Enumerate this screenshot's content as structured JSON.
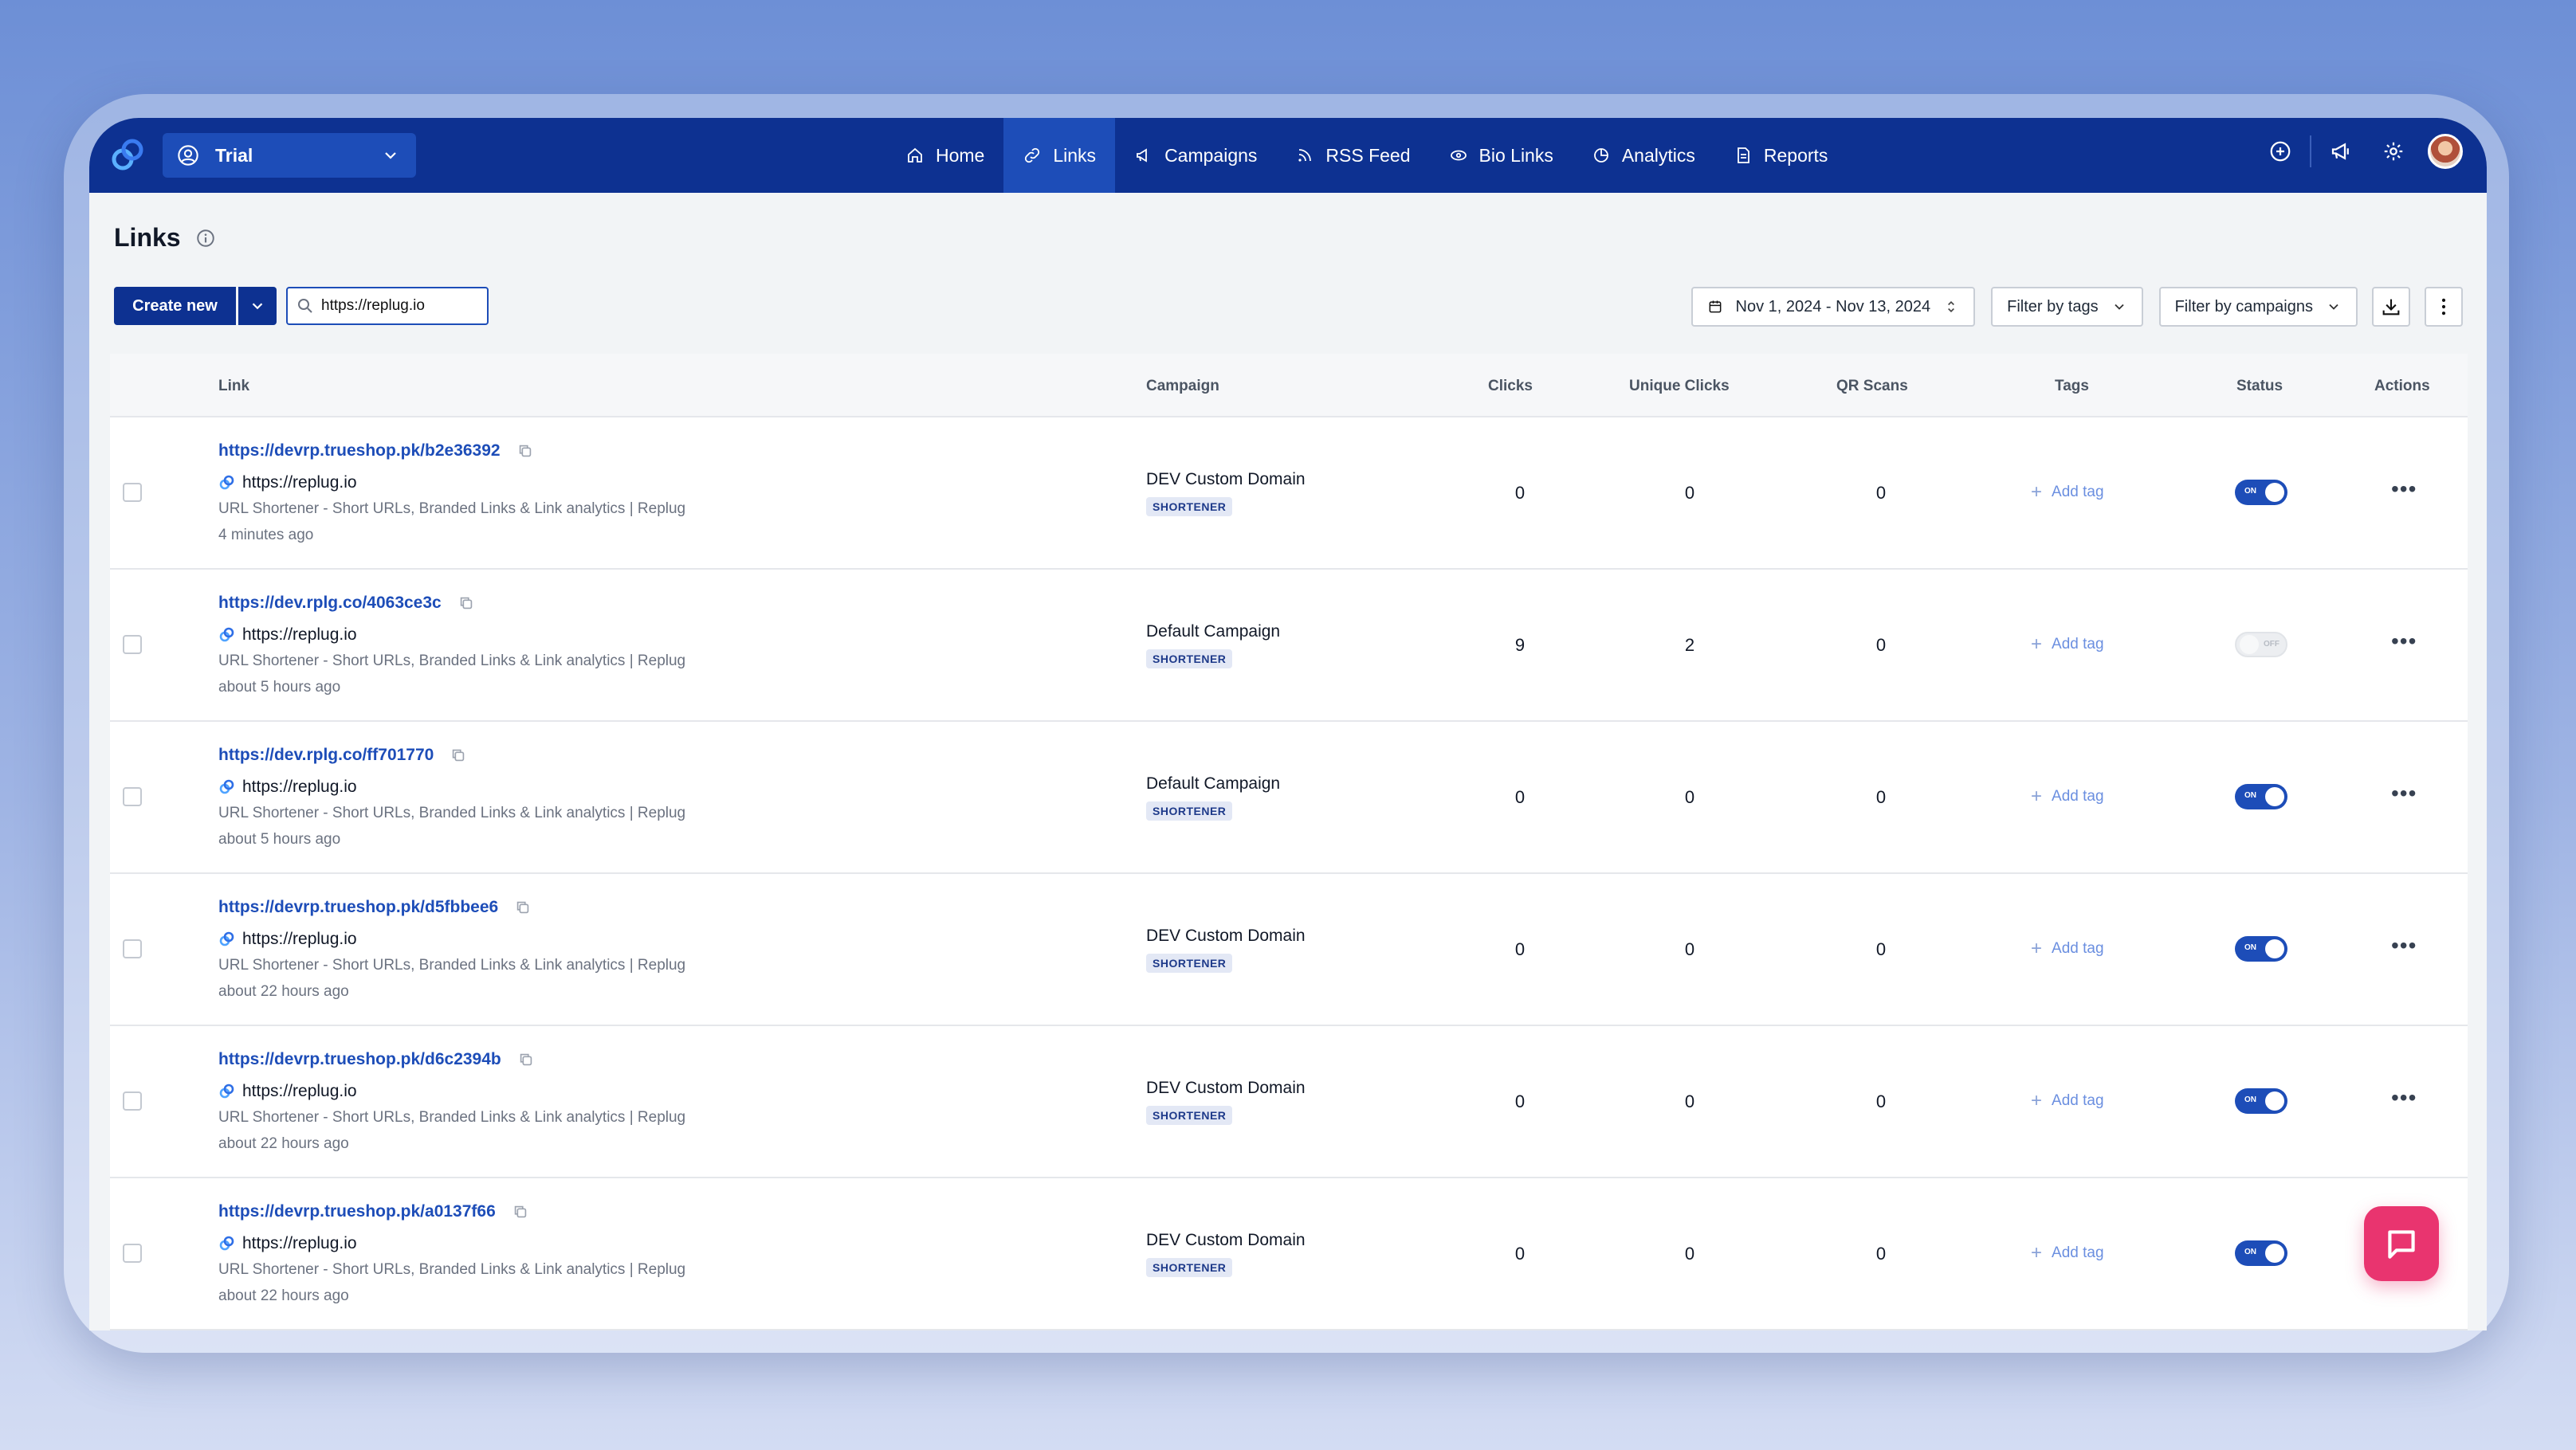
{
  "workspace": {
    "name": "Trial"
  },
  "nav": {
    "items": [
      {
        "label": "Home",
        "icon": "home-icon"
      },
      {
        "label": "Links",
        "icon": "link-icon",
        "active": true
      },
      {
        "label": "Campaigns",
        "icon": "megaphone-icon"
      },
      {
        "label": "RSS Feed",
        "icon": "rss-icon"
      },
      {
        "label": "Bio Links",
        "icon": "eye-link-icon"
      },
      {
        "label": "Analytics",
        "icon": "analytics-icon"
      },
      {
        "label": "Reports",
        "icon": "report-icon"
      }
    ]
  },
  "page": {
    "title": "Links"
  },
  "toolbar": {
    "create_label": "Create new",
    "search_value": "https://replug.io",
    "date_range": "Nov 1, 2024 - Nov 13, 2024",
    "filter_tags": "Filter by tags",
    "filter_campaigns": "Filter by campaigns"
  },
  "table": {
    "headers": {
      "link": "Link",
      "campaign": "Campaign",
      "clicks": "Clicks",
      "unique": "Unique Clicks",
      "qr": "QR Scans",
      "tags": "Tags",
      "status": "Status",
      "actions": "Actions"
    },
    "add_tag_label": "Add tag",
    "badge_label": "SHORTENER",
    "on_label": "ON",
    "off_label": "OFF",
    "rows": [
      {
        "short_url": "https://devrp.trueshop.pk/b2e36392",
        "destination": "https://replug.io",
        "meta": "URL Shortener - Short URLs, Branded Links & Link analytics | Replug",
        "time": "4 minutes ago",
        "campaign": "DEV Custom Domain",
        "clicks": "0",
        "unique_clicks": "0",
        "qr_scans": "0",
        "status": "on"
      },
      {
        "short_url": "https://dev.rplg.co/4063ce3c",
        "destination": "https://replug.io",
        "meta": "URL Shortener - Short URLs, Branded Links & Link analytics | Replug",
        "time": "about 5 hours ago",
        "campaign": "Default Campaign",
        "clicks": "9",
        "unique_clicks": "2",
        "qr_scans": "0",
        "status": "off"
      },
      {
        "short_url": "https://dev.rplg.co/ff701770",
        "destination": "https://replug.io",
        "meta": "URL Shortener - Short URLs, Branded Links & Link analytics | Replug",
        "time": "about 5 hours ago",
        "campaign": "Default Campaign",
        "clicks": "0",
        "unique_clicks": "0",
        "qr_scans": "0",
        "status": "on"
      },
      {
        "short_url": "https://devrp.trueshop.pk/d5fbbee6",
        "destination": "https://replug.io",
        "meta": "URL Shortener - Short URLs, Branded Links & Link analytics | Replug",
        "time": "about 22 hours ago",
        "campaign": "DEV Custom Domain",
        "clicks": "0",
        "unique_clicks": "0",
        "qr_scans": "0",
        "status": "on"
      },
      {
        "short_url": "https://devrp.trueshop.pk/d6c2394b",
        "destination": "https://replug.io",
        "meta": "URL Shortener - Short URLs, Branded Links & Link analytics | Replug",
        "time": "about 22 hours ago",
        "campaign": "DEV Custom Domain",
        "clicks": "0",
        "unique_clicks": "0",
        "qr_scans": "0",
        "status": "on"
      },
      {
        "short_url": "https://devrp.trueshop.pk/a0137f66",
        "destination": "https://replug.io",
        "meta": "URL Shortener - Short URLs, Branded Links & Link analytics | Replug",
        "time": "about 22 hours ago",
        "campaign": "DEV Custom Domain",
        "clicks": "0",
        "unique_clicks": "0",
        "qr_scans": "0",
        "status": "on"
      }
    ]
  },
  "colors": {
    "nav_bg": "#0d3191",
    "accent": "#1d4db8",
    "chat": "#e9346f"
  }
}
